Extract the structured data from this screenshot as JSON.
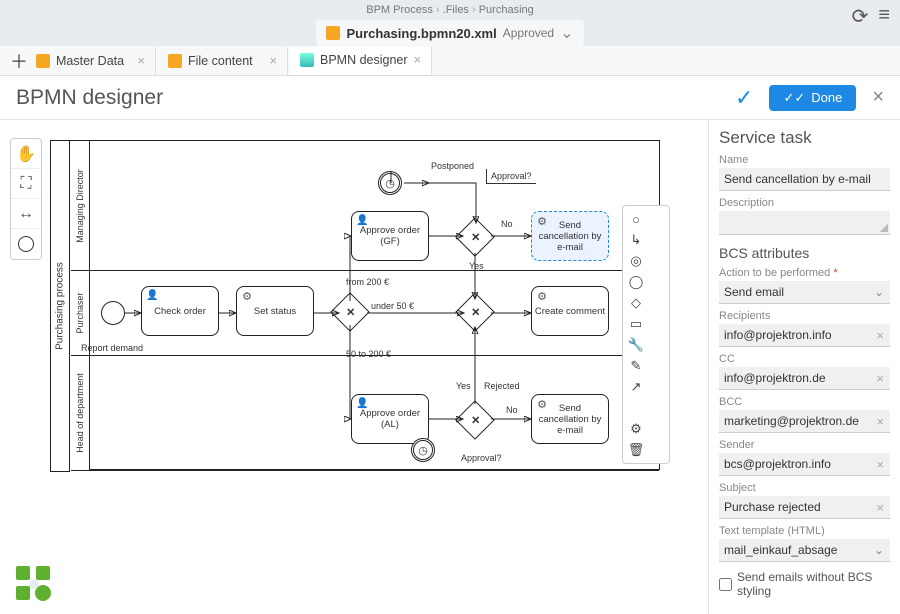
{
  "breadcrumb": [
    "BPM Process",
    ".Files",
    "Purchasing"
  ],
  "file": {
    "name": "Purchasing.bpmn20.xml",
    "status": "Approved"
  },
  "tabs": [
    {
      "label": "Master Data"
    },
    {
      "label": "File content"
    },
    {
      "label": "BPMN designer",
      "active": true
    }
  ],
  "page_title": "BPMN designer",
  "done_label": "Done",
  "pool_name": "Purchasing process",
  "lanes": {
    "l1": "Managing Director",
    "l2": "Purchaser",
    "l3": "Head of department"
  },
  "tasks": {
    "check_order": "Check order",
    "set_status": "Set status",
    "approve_gf": "Approve order (GF)",
    "send_cancel_1": "Send cancellation by e-mail",
    "create_comment": "Create comment",
    "approve_al": "Approve order (AL)",
    "send_cancel_2": "Send cancellation by e-mail"
  },
  "labels": {
    "postponed": "Postponed",
    "approval_top": "Approval?",
    "no": "No",
    "yes_top": "Yes",
    "from200": "from 200 €",
    "under50": "under 50 €",
    "to200": "50 to 200 €",
    "yes_bot": "Yes",
    "rejected": "Rejected",
    "no_bot": "No",
    "approval_bot": "Approval?",
    "report_demand": "Report demand"
  },
  "panel": {
    "title": "Service task",
    "name_label": "Name",
    "name_value": "Send cancellation by e-mail",
    "desc_label": "Description",
    "bcs_title": "BCS attributes",
    "action_label": "Action to be performed",
    "action_value": "Send email",
    "recipients_label": "Recipients",
    "recipients_value": "info@projektron.info",
    "cc_label": "CC",
    "cc_value": "info@projektron.de",
    "bcc_label": "BCC",
    "bcc_value": "marketing@projektron.de",
    "sender_label": "Sender",
    "sender_value": "bcs@projektron.info",
    "subject_label": "Subject",
    "subject_value": "Purchase rejected",
    "template_label": "Text template (HTML)",
    "template_value": "mail_einkauf_absage",
    "chk_label": "Send emails without BCS styling"
  }
}
